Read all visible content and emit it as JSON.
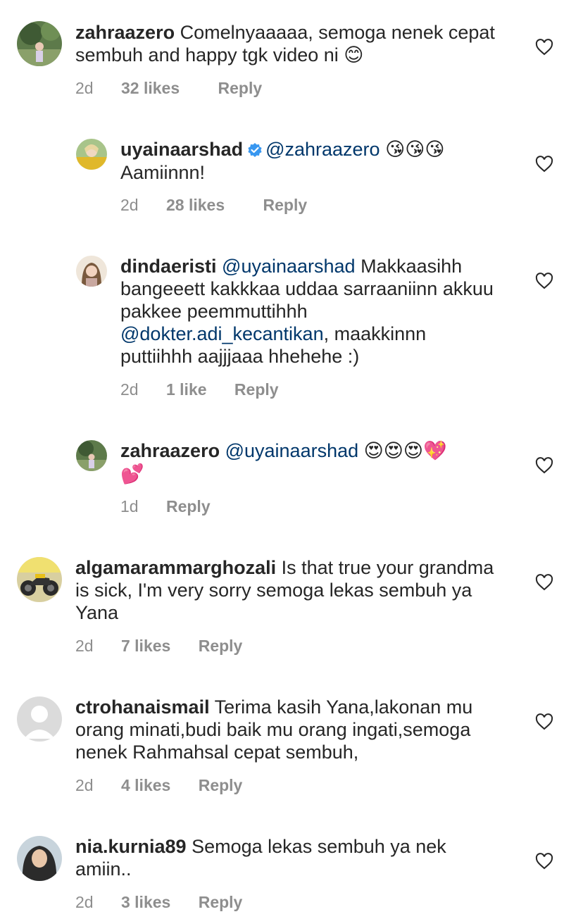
{
  "comments": [
    {
      "username": "zahraazero",
      "text": "Comelnyaaaaa, semoga nenek cepat sembuh and happy tgk video ni 😊",
      "time": "2d",
      "likes": "32 likes",
      "reply": "Reply"
    },
    {
      "username": "uyainaarshad",
      "verified": true,
      "mention": "@zahraazero",
      "emojis": "😘😘😘",
      "text": "Aamiinnn!",
      "time": "2d",
      "likes": "28 likes",
      "reply": "Reply"
    },
    {
      "username": "dindaeristi",
      "mention": "@uyainaarshad",
      "text_a": "Makkaasihh bangeeett kakkkaa uddaa sarraaniinn akkuu pakkee peemmuttihhh",
      "mention2": "@dokter.adi_kecantikan",
      "text_b": ", maakkinnn puttiihhh aajjjaaa hhehehe :)",
      "time": "2d",
      "likes": "1 like",
      "reply": "Reply"
    },
    {
      "username": "zahraazero",
      "mention": "@uyainaarshad",
      "emojis": "😍😍😍💖",
      "emojis2": "💕",
      "time": "1d",
      "reply": "Reply"
    },
    {
      "username": "algamarammarghozali",
      "text": "Is that true your grandma is sick, I'm very sorry semoga lekas sembuh ya Yana",
      "time": "2d",
      "likes": "7 likes",
      "reply": "Reply"
    },
    {
      "username": "ctrohanaismail",
      "text": "Terima kasih Yana,lakonan mu orang minati,budi baik mu orang ingati,semoga nenek Rahmahsal cepat sembuh,",
      "time": "2d",
      "likes": "4 likes",
      "reply": "Reply"
    },
    {
      "username": "nia.kurnia89",
      "text": "Semoga lekas sembuh ya nek amiin..",
      "time": "2d",
      "likes": "3 likes",
      "reply": "Reply"
    }
  ],
  "icons": {
    "like": "heart-outline-icon",
    "verified": "verified-badge-icon"
  },
  "colors": {
    "text": "#262626",
    "meta": "#8e8e8e",
    "mention": "#00376b",
    "verified": "#3897f0"
  }
}
